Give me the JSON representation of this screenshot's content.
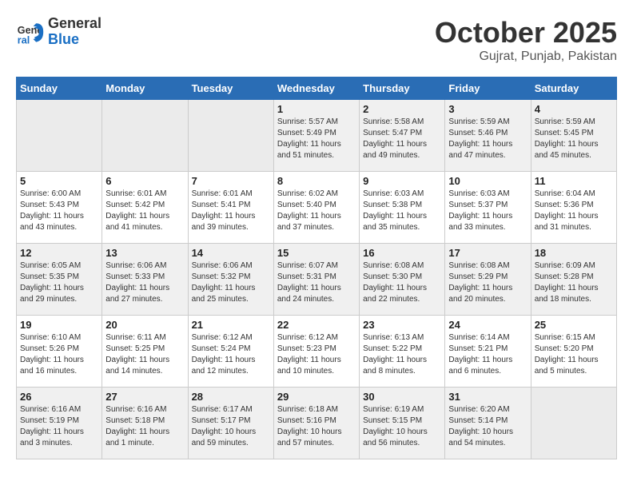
{
  "header": {
    "logo_line1": "General",
    "logo_line2": "Blue",
    "month": "October 2025",
    "location": "Gujrat, Punjab, Pakistan"
  },
  "weekdays": [
    "Sunday",
    "Monday",
    "Tuesday",
    "Wednesday",
    "Thursday",
    "Friday",
    "Saturday"
  ],
  "weeks": [
    [
      {
        "day": "",
        "info": ""
      },
      {
        "day": "",
        "info": ""
      },
      {
        "day": "",
        "info": ""
      },
      {
        "day": "1",
        "info": "Sunrise: 5:57 AM\nSunset: 5:49 PM\nDaylight: 11 hours\nand 51 minutes."
      },
      {
        "day": "2",
        "info": "Sunrise: 5:58 AM\nSunset: 5:47 PM\nDaylight: 11 hours\nand 49 minutes."
      },
      {
        "day": "3",
        "info": "Sunrise: 5:59 AM\nSunset: 5:46 PM\nDaylight: 11 hours\nand 47 minutes."
      },
      {
        "day": "4",
        "info": "Sunrise: 5:59 AM\nSunset: 5:45 PM\nDaylight: 11 hours\nand 45 minutes."
      }
    ],
    [
      {
        "day": "5",
        "info": "Sunrise: 6:00 AM\nSunset: 5:43 PM\nDaylight: 11 hours\nand 43 minutes."
      },
      {
        "day": "6",
        "info": "Sunrise: 6:01 AM\nSunset: 5:42 PM\nDaylight: 11 hours\nand 41 minutes."
      },
      {
        "day": "7",
        "info": "Sunrise: 6:01 AM\nSunset: 5:41 PM\nDaylight: 11 hours\nand 39 minutes."
      },
      {
        "day": "8",
        "info": "Sunrise: 6:02 AM\nSunset: 5:40 PM\nDaylight: 11 hours\nand 37 minutes."
      },
      {
        "day": "9",
        "info": "Sunrise: 6:03 AM\nSunset: 5:38 PM\nDaylight: 11 hours\nand 35 minutes."
      },
      {
        "day": "10",
        "info": "Sunrise: 6:03 AM\nSunset: 5:37 PM\nDaylight: 11 hours\nand 33 minutes."
      },
      {
        "day": "11",
        "info": "Sunrise: 6:04 AM\nSunset: 5:36 PM\nDaylight: 11 hours\nand 31 minutes."
      }
    ],
    [
      {
        "day": "12",
        "info": "Sunrise: 6:05 AM\nSunset: 5:35 PM\nDaylight: 11 hours\nand 29 minutes."
      },
      {
        "day": "13",
        "info": "Sunrise: 6:06 AM\nSunset: 5:33 PM\nDaylight: 11 hours\nand 27 minutes."
      },
      {
        "day": "14",
        "info": "Sunrise: 6:06 AM\nSunset: 5:32 PM\nDaylight: 11 hours\nand 25 minutes."
      },
      {
        "day": "15",
        "info": "Sunrise: 6:07 AM\nSunset: 5:31 PM\nDaylight: 11 hours\nand 24 minutes."
      },
      {
        "day": "16",
        "info": "Sunrise: 6:08 AM\nSunset: 5:30 PM\nDaylight: 11 hours\nand 22 minutes."
      },
      {
        "day": "17",
        "info": "Sunrise: 6:08 AM\nSunset: 5:29 PM\nDaylight: 11 hours\nand 20 minutes."
      },
      {
        "day": "18",
        "info": "Sunrise: 6:09 AM\nSunset: 5:28 PM\nDaylight: 11 hours\nand 18 minutes."
      }
    ],
    [
      {
        "day": "19",
        "info": "Sunrise: 6:10 AM\nSunset: 5:26 PM\nDaylight: 11 hours\nand 16 minutes."
      },
      {
        "day": "20",
        "info": "Sunrise: 6:11 AM\nSunset: 5:25 PM\nDaylight: 11 hours\nand 14 minutes."
      },
      {
        "day": "21",
        "info": "Sunrise: 6:12 AM\nSunset: 5:24 PM\nDaylight: 11 hours\nand 12 minutes."
      },
      {
        "day": "22",
        "info": "Sunrise: 6:12 AM\nSunset: 5:23 PM\nDaylight: 11 hours\nand 10 minutes."
      },
      {
        "day": "23",
        "info": "Sunrise: 6:13 AM\nSunset: 5:22 PM\nDaylight: 11 hours\nand 8 minutes."
      },
      {
        "day": "24",
        "info": "Sunrise: 6:14 AM\nSunset: 5:21 PM\nDaylight: 11 hours\nand 6 minutes."
      },
      {
        "day": "25",
        "info": "Sunrise: 6:15 AM\nSunset: 5:20 PM\nDaylight: 11 hours\nand 5 minutes."
      }
    ],
    [
      {
        "day": "26",
        "info": "Sunrise: 6:16 AM\nSunset: 5:19 PM\nDaylight: 11 hours\nand 3 minutes."
      },
      {
        "day": "27",
        "info": "Sunrise: 6:16 AM\nSunset: 5:18 PM\nDaylight: 11 hours\nand 1 minute."
      },
      {
        "day": "28",
        "info": "Sunrise: 6:17 AM\nSunset: 5:17 PM\nDaylight: 10 hours\nand 59 minutes."
      },
      {
        "day": "29",
        "info": "Sunrise: 6:18 AM\nSunset: 5:16 PM\nDaylight: 10 hours\nand 57 minutes."
      },
      {
        "day": "30",
        "info": "Sunrise: 6:19 AM\nSunset: 5:15 PM\nDaylight: 10 hours\nand 56 minutes."
      },
      {
        "day": "31",
        "info": "Sunrise: 6:20 AM\nSunset: 5:14 PM\nDaylight: 10 hours\nand 54 minutes."
      },
      {
        "day": "",
        "info": ""
      }
    ]
  ]
}
